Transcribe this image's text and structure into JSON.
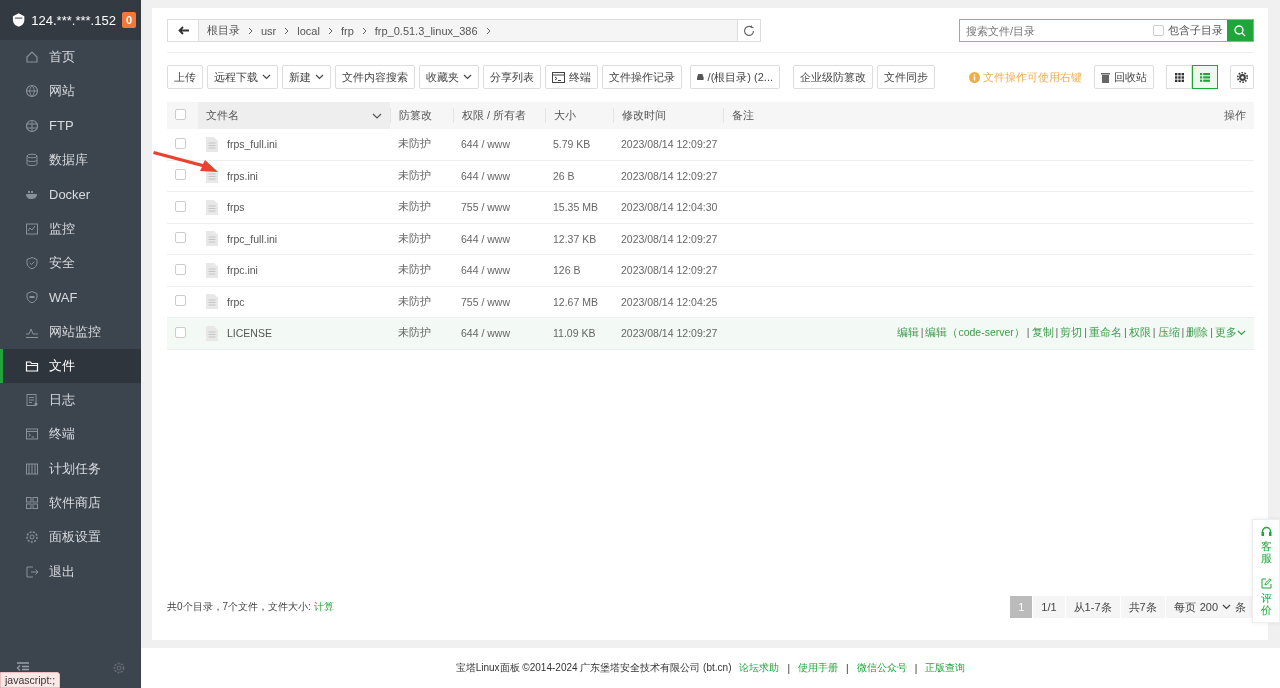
{
  "sidebar": {
    "server": "124.***.***.152",
    "badge": "0",
    "items": [
      {
        "label": "首页",
        "selected": false
      },
      {
        "label": "网站",
        "selected": false
      },
      {
        "label": "FTP",
        "selected": false
      },
      {
        "label": "数据库",
        "selected": false
      },
      {
        "label": "Docker",
        "selected": false
      },
      {
        "label": "监控",
        "selected": false
      },
      {
        "label": "安全",
        "selected": false
      },
      {
        "label": "WAF",
        "selected": false
      },
      {
        "label": "网站监控",
        "selected": false
      },
      {
        "label": "文件",
        "selected": true
      },
      {
        "label": "日志",
        "selected": false
      },
      {
        "label": "终端",
        "selected": false
      },
      {
        "label": "计划任务",
        "selected": false
      },
      {
        "label": "软件商店",
        "selected": false
      },
      {
        "label": "面板设置",
        "selected": false
      },
      {
        "label": "退出",
        "selected": false
      }
    ]
  },
  "breadcrumb": [
    "根目录",
    "usr",
    "local",
    "frp",
    "frp_0.51.3_linux_386"
  ],
  "search": {
    "placeholder": "搜索文件/目录",
    "subdir_label": "包含子目录",
    "subdir_checked": false
  },
  "toolbar": [
    {
      "kind": "plain",
      "label": "上传"
    },
    {
      "kind": "dropdown",
      "label": "远程下载"
    },
    {
      "kind": "dropdown",
      "label": "新建"
    },
    {
      "kind": "plain",
      "label": "文件内容搜索"
    },
    {
      "kind": "dropdown",
      "label": "收藏夹"
    },
    {
      "kind": "plain",
      "label": "分享列表"
    },
    {
      "kind": "terminal",
      "label": "终端"
    },
    {
      "kind": "plain",
      "label": "文件操作记录"
    },
    {
      "kind": "disk",
      "label": "/(根目录) (2..."
    },
    {
      "kind": "plain",
      "label": "企业级防篡改"
    },
    {
      "kind": "plain",
      "label": "文件同步"
    }
  ],
  "tip": "文件操作可使用右键",
  "recycle_bin": "回收站",
  "views": [
    {
      "kind": "grid",
      "selected": false
    },
    {
      "kind": "list",
      "selected": true
    }
  ],
  "table": {
    "select_all_checked": false,
    "columns": [
      "文件名",
      "防篡改",
      "权限 / 所有者",
      "大小",
      "修改时间",
      "备注",
      "操作"
    ],
    "rows": [
      {
        "name": "frps_full.ini",
        "protect": "未防护",
        "perm": "644 / www",
        "size": "5.79 KB",
        "mtime": "2023/08/14 12:09:27",
        "checked": false,
        "hovered": false
      },
      {
        "name": "frps.ini",
        "protect": "未防护",
        "perm": "644 / www",
        "size": "26 B",
        "mtime": "2023/08/14 12:09:27",
        "checked": false,
        "hovered": false
      },
      {
        "name": "frps",
        "protect": "未防护",
        "perm": "755 / www",
        "size": "15.35 MB",
        "mtime": "2023/08/14 12:04:30",
        "checked": false,
        "hovered": false
      },
      {
        "name": "frpc_full.ini",
        "protect": "未防护",
        "perm": "644 / www",
        "size": "12.37 KB",
        "mtime": "2023/08/14 12:09:27",
        "checked": false,
        "hovered": false
      },
      {
        "name": "frpc.ini",
        "protect": "未防护",
        "perm": "644 / www",
        "size": "126 B",
        "mtime": "2023/08/14 12:09:27",
        "checked": false,
        "hovered": false
      },
      {
        "name": "frpc",
        "protect": "未防护",
        "perm": "755 / www",
        "size": "12.67 MB",
        "mtime": "2023/08/14 12:04:25",
        "checked": false,
        "hovered": false
      },
      {
        "name": "LICENSE",
        "protect": "未防护",
        "perm": "644 / www",
        "size": "11.09 KB",
        "mtime": "2023/08/14 12:09:27",
        "checked": false,
        "hovered": true,
        "separator": "|",
        "actions": [
          "编辑",
          "编辑（code-server）",
          "复制",
          "剪切",
          "重命名",
          "权限",
          "压缩",
          "删除",
          "更多"
        ]
      }
    ]
  },
  "summary": {
    "text": "共0个目录，7个文件，文件大小:",
    "link": "计算"
  },
  "pagination": {
    "pages": [
      {
        "label": "1",
        "selected": true
      }
    ],
    "info": [
      "1/1",
      "从1-7条",
      "共7条"
    ],
    "per_page_label": "每页",
    "per_page": "200",
    "per_page_unit": "条"
  },
  "float_widget": [
    "客服",
    "评价"
  ],
  "footer": {
    "copyright": "宝塔Linux面板 ©2014-2024 广东堡塔安全技术有限公司 (bt.cn)",
    "separator": "|",
    "links": [
      "论坛求助",
      "使用手册",
      "微信公众号",
      "正版查询"
    ]
  },
  "status_tip": "javascript:;"
}
